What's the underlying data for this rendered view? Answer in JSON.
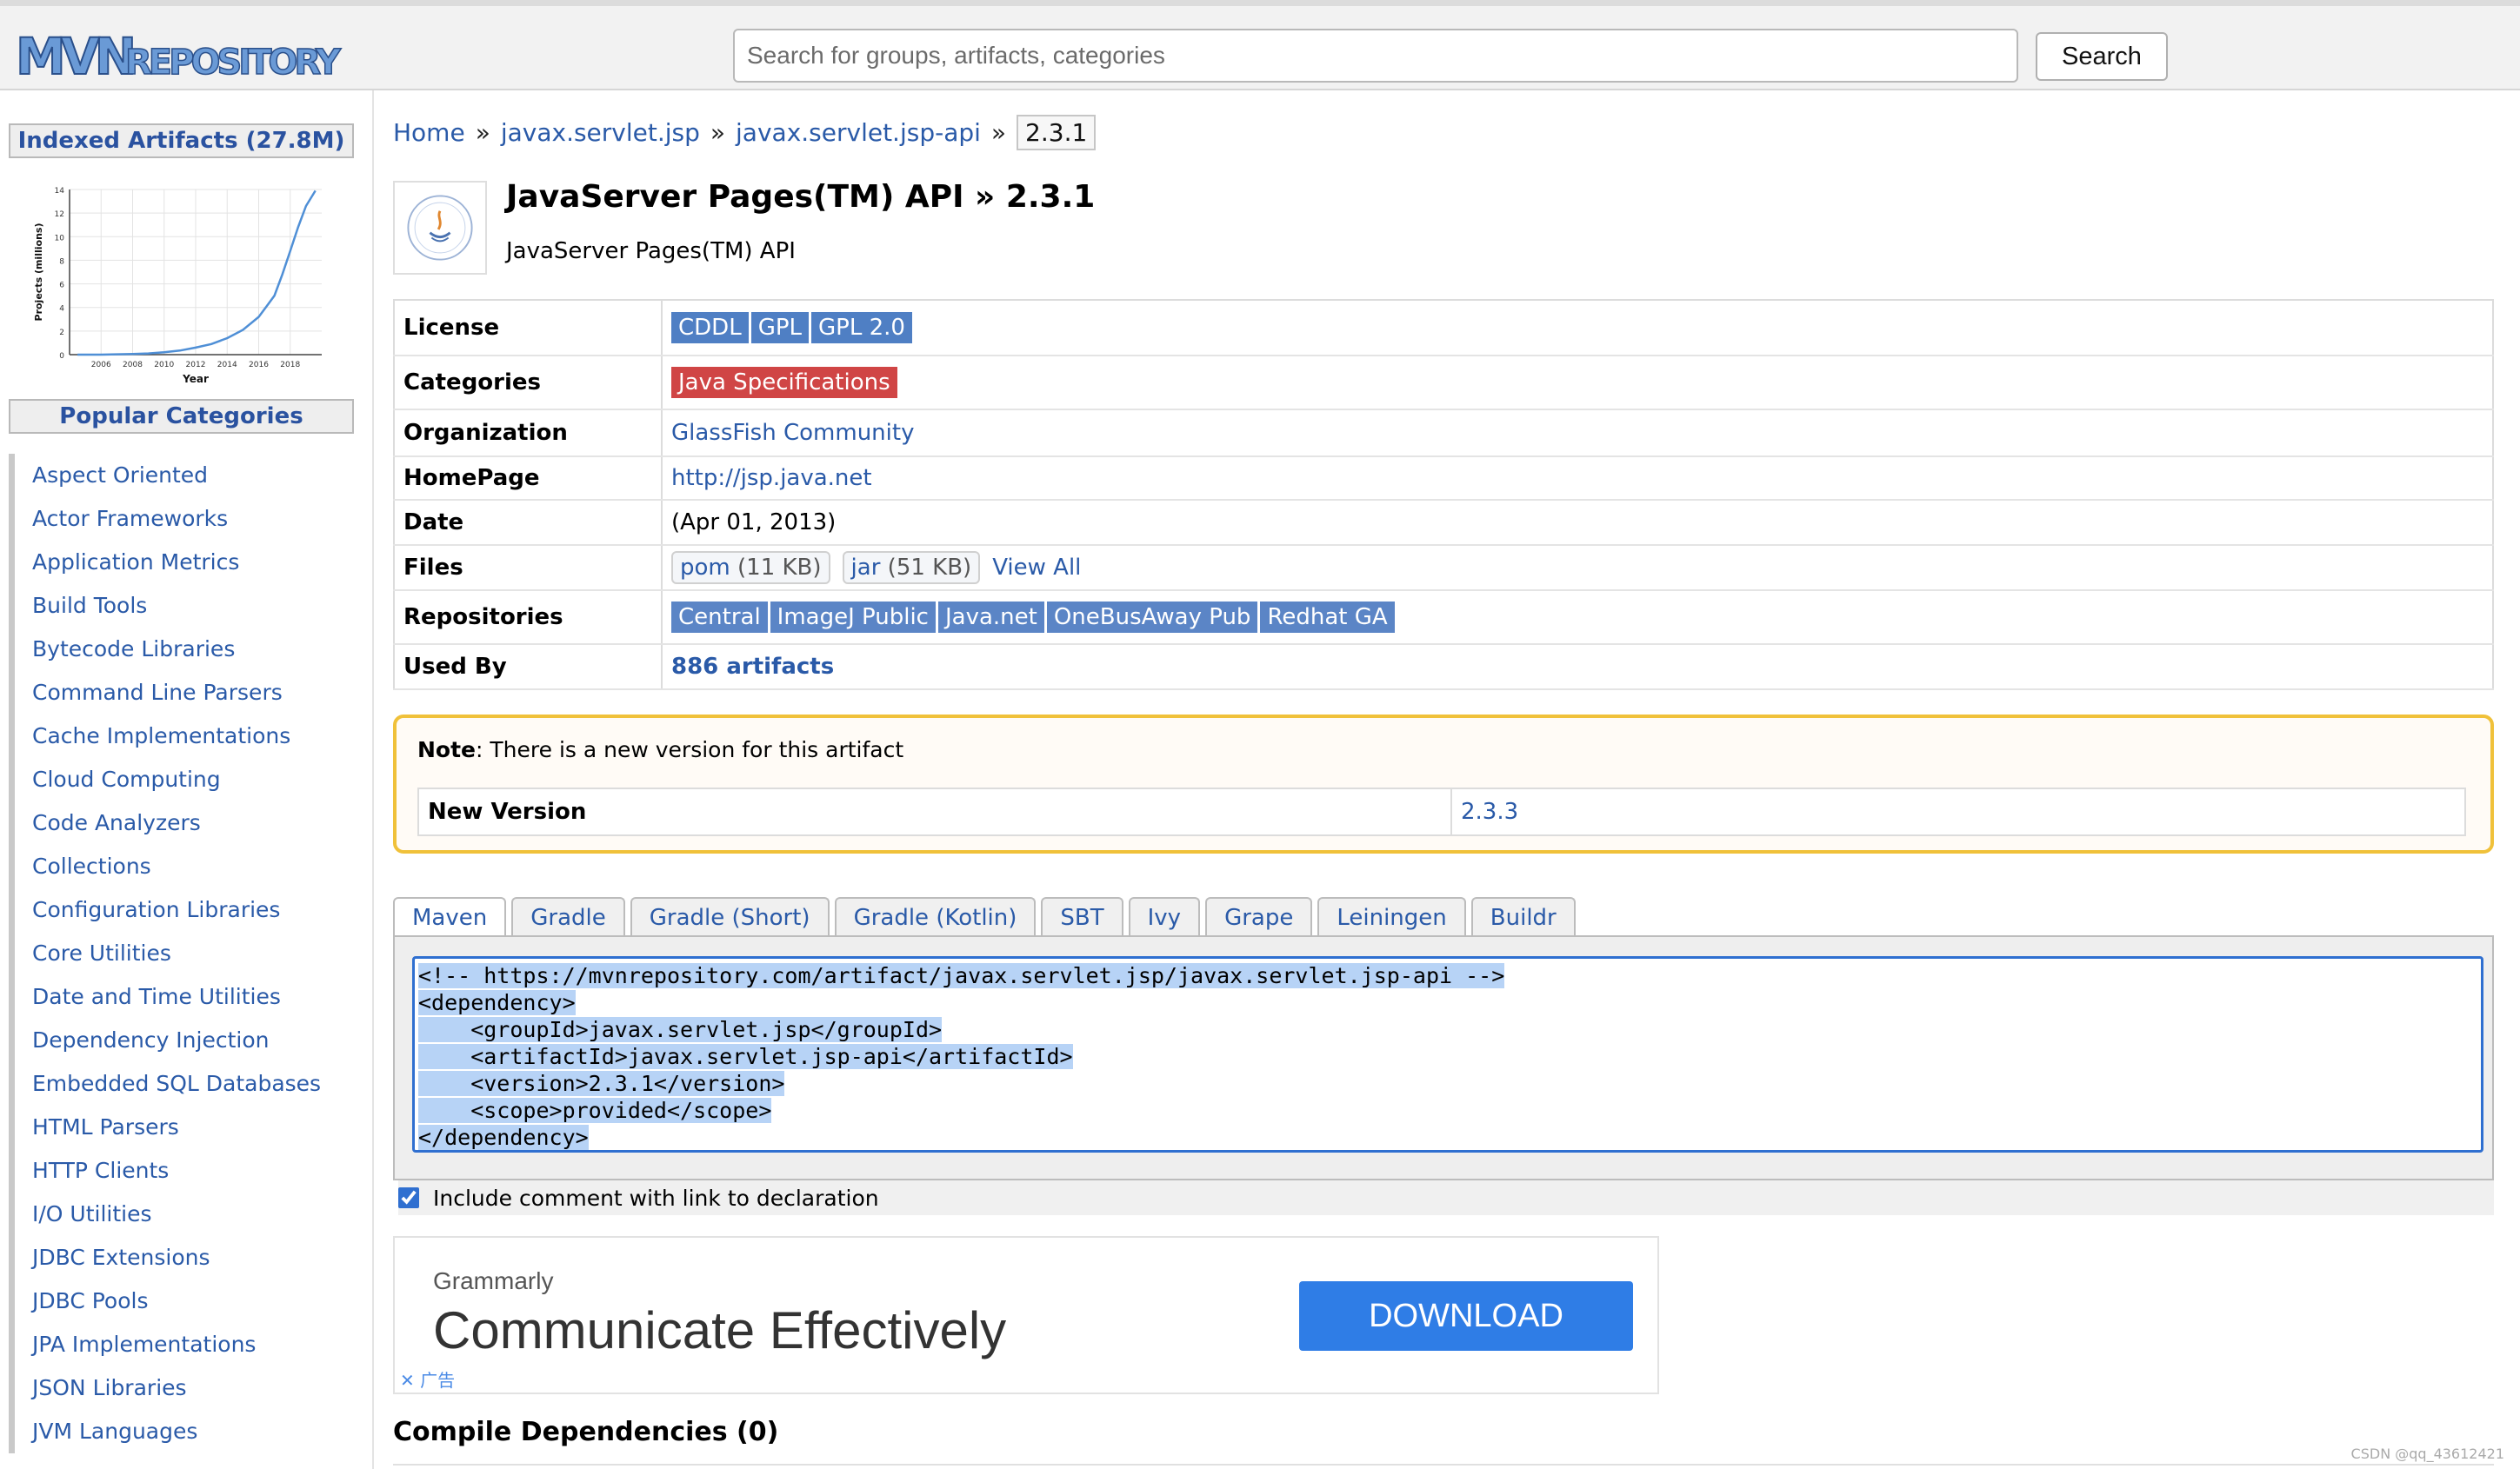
{
  "header": {
    "logo_text": "MVNREPOSITORY",
    "search_placeholder": "Search for groups, artifacts, categories",
    "search_button": "Search"
  },
  "sidebar": {
    "indexed_heading": "Indexed Artifacts (27.8M)",
    "popular_heading": "Popular Categories",
    "categories": [
      "Aspect Oriented",
      "Actor Frameworks",
      "Application Metrics",
      "Build Tools",
      "Bytecode Libraries",
      "Command Line Parsers",
      "Cache Implementations",
      "Cloud Computing",
      "Code Analyzers",
      "Collections",
      "Configuration Libraries",
      "Core Utilities",
      "Date and Time Utilities",
      "Dependency Injection",
      "Embedded SQL Databases",
      "HTML Parsers",
      "HTTP Clients",
      "I/O Utilities",
      "JDBC Extensions",
      "JDBC Pools",
      "JPA Implementations",
      "JSON Libraries",
      "JVM Languages"
    ]
  },
  "chart_data": {
    "type": "line",
    "title": "",
    "xlabel": "Year",
    "ylabel": "Projects (millions)",
    "x_ticks": [
      "2006",
      "2008",
      "2010",
      "2012",
      "2014",
      "2016",
      "2018"
    ],
    "y_ticks": [
      "0",
      "2",
      "4",
      "6",
      "8",
      "10",
      "12",
      "14"
    ],
    "xlim": [
      2004,
      2020
    ],
    "ylim": [
      0,
      14
    ],
    "series": [
      {
        "x": [
          2004.5,
          2006,
          2008,
          2009,
          2010,
          2011,
          2012,
          2013,
          2014,
          2015,
          2016,
          2016.5,
          2017,
          2017.5,
          2018,
          2018.5,
          2019,
          2019.6
        ],
        "values": [
          0,
          0,
          0.05,
          0.1,
          0.2,
          0.35,
          0.6,
          0.9,
          1.4,
          2.1,
          3.2,
          4.1,
          5.0,
          6.8,
          8.8,
          10.8,
          12.6,
          13.9
        ]
      }
    ],
    "line_color": "#4f8fd6",
    "grid": true
  },
  "breadcrumb": {
    "home": "Home",
    "group": "javax.servlet.jsp",
    "artifact": "javax.servlet.jsp-api",
    "version": "2.3.1",
    "separator": "»"
  },
  "artifact": {
    "title": "JavaServer Pages(TM) API » 2.3.1",
    "subtitle": "JavaServer Pages(TM) API"
  },
  "info": {
    "license_label": "License",
    "licenses": [
      "CDDL",
      "GPL",
      "GPL 2.0"
    ],
    "categories_label": "Categories",
    "category": "Java Specifications",
    "organization_label": "Organization",
    "organization": "GlassFish Community",
    "homepage_label": "HomePage",
    "homepage": "http://jsp.java.net",
    "date_label": "Date",
    "date": "(Apr 01, 2013)",
    "files_label": "Files",
    "files": [
      {
        "name": "pom",
        "size": "(11 KB)"
      },
      {
        "name": "jar",
        "size": "(51 KB)"
      }
    ],
    "view_all": "View All",
    "repositories_label": "Repositories",
    "repositories": [
      "Central",
      "ImageJ Public",
      "Java.net",
      "OneBusAway Pub",
      "Redhat GA"
    ],
    "used_by_label": "Used By",
    "used_by": "886 artifacts"
  },
  "note": {
    "label": "Note",
    "text": ": There is a new version for this artifact",
    "new_version_label": "New Version",
    "new_version": "2.3.3"
  },
  "tabs": [
    "Maven",
    "Gradle",
    "Gradle (Short)",
    "Gradle (Kotlin)",
    "SBT",
    "Ivy",
    "Grape",
    "Leiningen",
    "Buildr"
  ],
  "code_lines": [
    "<!-- https://mvnrepository.com/artifact/javax.servlet.jsp/javax.servlet.jsp-api -->",
    "<dependency>",
    "    <groupId>javax.servlet.jsp</groupId>",
    "    <artifactId>javax.servlet.jsp-api</artifactId>",
    "    <version>2.3.1</version>",
    "    <scope>provided</scope>",
    "</dependency>"
  ],
  "include_comment": "Include comment with link to declaration",
  "ad": {
    "brand": "Grammarly",
    "headline": "Communicate Effectively",
    "button": "DOWNLOAD",
    "ad_label": "✕ 广告"
  },
  "compile_heading": "Compile Dependencies (0)",
  "watermark": "CSDN @qq_43612421",
  "colors": {
    "link": "#2a5aa8",
    "license_badge": "#4f7fc4",
    "category_badge": "#d04545",
    "note_border": "#f0c13a",
    "download_button": "#2f7de6"
  }
}
